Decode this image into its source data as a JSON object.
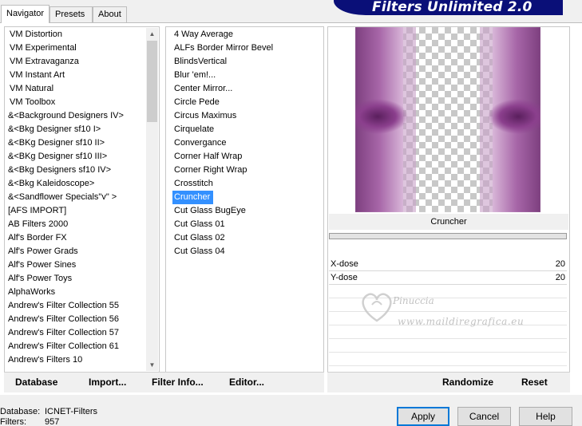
{
  "tabs": [
    "Navigator",
    "Presets",
    "About"
  ],
  "banner_title": "Filters Unlimited 2.0",
  "categories": [
    "VM Distortion",
    "VM Experimental",
    "VM Extravaganza",
    "VM Instant Art",
    "VM Natural",
    "VM Toolbox",
    "&<Background Designers IV>",
    "&<Bkg Designer sf10 I>",
    "&<BKg Designer sf10 II>",
    "&<BKg Designer sf10 III>",
    "&<Bkg Designers sf10 IV>",
    "&<Bkg Kaleidoscope>",
    "&<Sandflower Specials\"v\" >",
    "[AFS IMPORT]",
    "AB Filters 2000",
    "Alf's Border FX",
    "Alf's Power Grads",
    "Alf's Power Sines",
    "Alf's Power Toys",
    "AlphaWorks",
    "Andrew's Filter Collection 55",
    "Andrew's Filter Collection 56",
    "Andrew's Filter Collection 57",
    "Andrew's Filter Collection 61",
    "Andrew's Filters 10"
  ],
  "filters": [
    "4 Way Average",
    "ALFs Border Mirror Bevel",
    "BlindsVertical",
    "Blur 'em!...",
    "Center Mirror...",
    "Circle Pede",
    "Circus Maximus",
    "Cirquelate",
    "Convergance",
    "Corner Half Wrap",
    "Corner Right Wrap",
    "Crosstitch",
    "Cruncher",
    "Cut Glass  BugEye",
    "Cut Glass 01",
    "Cut Glass 02",
    "Cut Glass 04"
  ],
  "selected_filter": "Cruncher",
  "params": [
    {
      "label": "X-dose",
      "value": "20"
    },
    {
      "label": "Y-dose",
      "value": "20"
    }
  ],
  "watermark": {
    "name": "Pinuccia",
    "url": "www.maildiregrafica.eu"
  },
  "left_bar": {
    "database": "Database",
    "import": "Import...",
    "filter_info": "Filter Info...",
    "editor": "Editor..."
  },
  "right_bar": {
    "randomize": "Randomize",
    "reset": "Reset"
  },
  "status": {
    "database_label": "Database:",
    "database_value": "ICNET-Filters",
    "filters_label": "Filters:",
    "filters_value": "957"
  },
  "dialog": {
    "apply": "Apply",
    "cancel": "Cancel",
    "help": "Help"
  },
  "colors": {
    "banner": "#0a0f78",
    "selection": "#3390ff",
    "preview_purple": "#9a4f9c"
  }
}
